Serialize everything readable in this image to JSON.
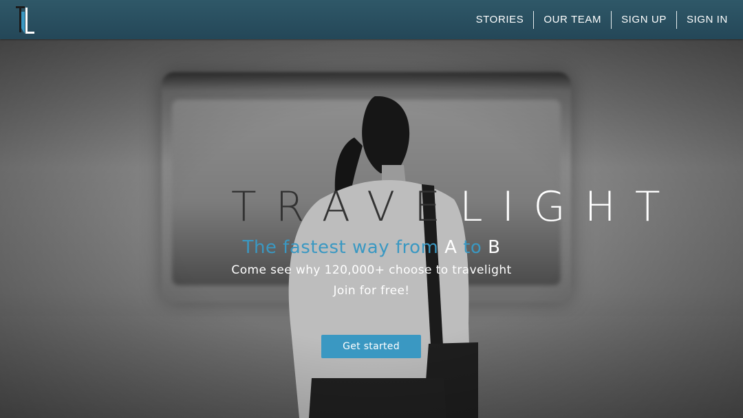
{
  "app": {
    "logo": {
      "text": "TL",
      "accent": "#3a98c2"
    }
  },
  "nav": {
    "items": [
      {
        "label": "STORIES"
      },
      {
        "label": "OUR TEAM"
      },
      {
        "label": "SIGN UP"
      },
      {
        "label": "SIGN IN"
      }
    ]
  },
  "hero": {
    "brand_dark": "TRAVE",
    "brand_light": "LIGHT",
    "tagline_blue_1": "The fastest way from",
    "tagline_white_1": "A",
    "tagline_blue_2": "to",
    "tagline_white_2": "B",
    "subline": "Come see why 120,000+ choose to travelight",
    "joinline": "Join for free!",
    "cta_label": "Get started"
  },
  "colors": {
    "header": "#2b5163",
    "accent": "#3a98c2",
    "brand_dark": "#333333",
    "brand_light": "#ffffff"
  }
}
